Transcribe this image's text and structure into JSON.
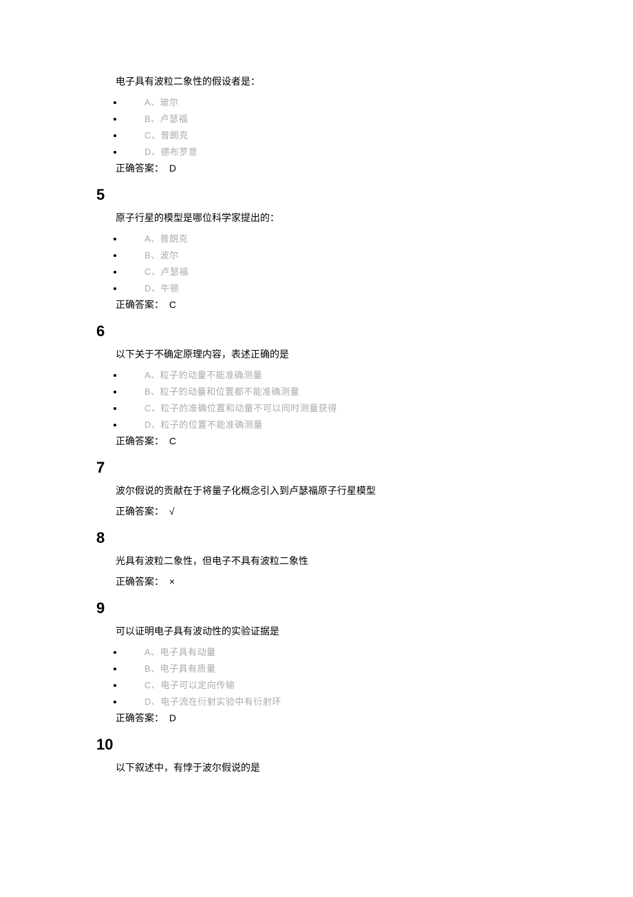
{
  "answer_label": "正确答案：",
  "q4": {
    "text": "电子具有波粒二象性的假设者是：",
    "options": [
      "A、玻尔",
      "B、卢瑟福",
      "C、普朗克",
      "D、德布罗意"
    ],
    "answer": "D"
  },
  "q5": {
    "num": "5",
    "text": "原子行星的模型是哪位科学家提出的：",
    "options": [
      "A、普朗克",
      "B、波尔",
      "C、卢瑟福",
      "D、牛顿"
    ],
    "answer": "C"
  },
  "q6": {
    "num": "6",
    "text": "以下关于不确定原理内容，表述正确的是",
    "options": [
      "A、粒子的动量不能准确测量",
      "B、粒子的动量和位置都不能准确测量",
      "C、粒子的准确位置和动量不可以同时测量获得",
      "D、粒子的位置不能准确测量"
    ],
    "answer": "C"
  },
  "q7": {
    "num": "7",
    "text": "波尔假说的贡献在于将量子化概念引入到卢瑟福原子行星模型",
    "answer": "√"
  },
  "q8": {
    "num": "8",
    "text": "光具有波粒二象性，但电子不具有波粒二象性",
    "answer": "×"
  },
  "q9": {
    "num": "9",
    "text": "可以证明电子具有波动性的实验证据是",
    "options": [
      "A、电子具有动量",
      "B、电子具有质量",
      "C、电子可以定向传输",
      "D、电子流在衍射实验中有衍射环"
    ],
    "answer": "D"
  },
  "q10": {
    "num": "10",
    "text": "以下叙述中，有悖于波尔假说的是"
  }
}
